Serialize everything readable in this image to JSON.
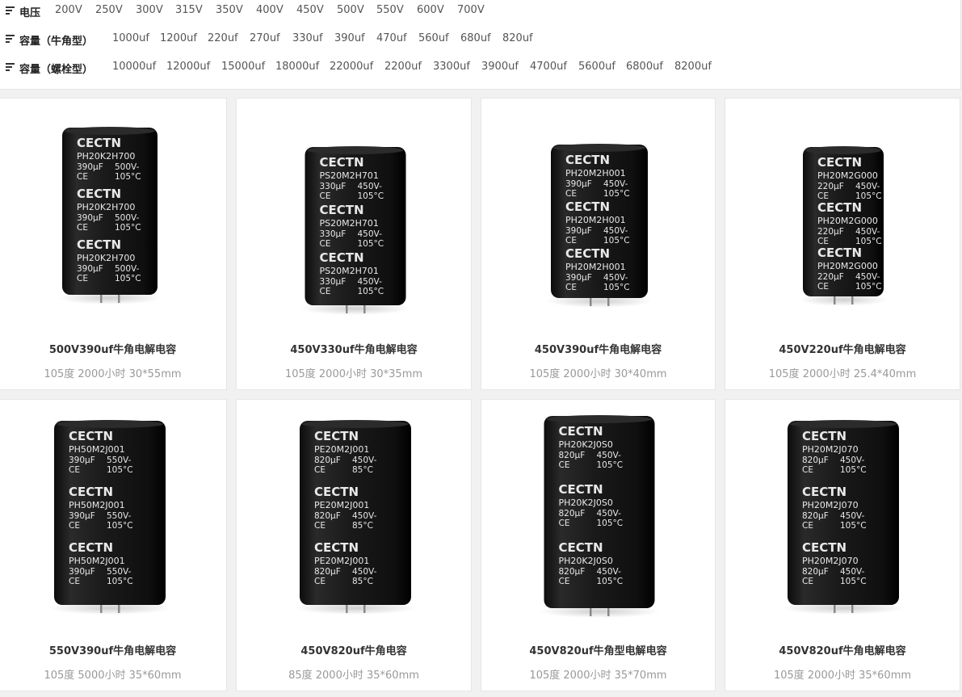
{
  "filters": [
    {
      "label": "电压",
      "options": [
        "200V",
        "250V",
        "300V",
        "315V",
        "350V",
        "400V",
        "450V",
        "500V",
        "550V",
        "600V",
        "700V"
      ]
    },
    {
      "label": "容量（牛角型）",
      "options": [
        "1000uf",
        "1200uf",
        "220uf",
        "270uf",
        "330uf",
        "390uf",
        "470uf",
        "560uf",
        "680uf",
        "820uf"
      ]
    },
    {
      "label": "容量（螺栓型）",
      "options": [
        "10000uf",
        "12000uf",
        "15000uf",
        "18000uf",
        "22000uf",
        "2200uf",
        "3300uf",
        "3900uf",
        "4700uf",
        "5600uf",
        "6800uf",
        "8200uf"
      ]
    }
  ],
  "products": [
    {
      "title": "500V390uf牛角电解电容",
      "spec": "105度 2000小时 30*55mm",
      "printing": {
        "brand": "CECTN",
        "model": "PH20K2H700",
        "cap": "390µF",
        "volt": "500V-",
        "ce": "CE",
        "temp": "105°C"
      }
    },
    {
      "title": "450V330uf牛角电解电容",
      "spec": "105度 2000小时 30*35mm",
      "printing": {
        "brand": "CECTN",
        "model": "PS20M2H701",
        "cap": "330µF",
        "volt": "450V-",
        "ce": "CE",
        "temp": "105°C"
      }
    },
    {
      "title": "450V390uf牛角电解电容",
      "spec": "105度 2000小时 30*40mm",
      "printing": {
        "brand": "CECTN",
        "model": "PH20M2H001",
        "cap": "390µF",
        "volt": "450V-",
        "ce": "CE",
        "temp": "105°C"
      }
    },
    {
      "title": "450V220uf牛角电解电容",
      "spec": "105度 2000小时 25.4*40mm",
      "printing": {
        "brand": "CECTN",
        "model": "PH20M2G000",
        "cap": "220µF",
        "volt": "450V-",
        "ce": "CE",
        "temp": "105°C"
      }
    },
    {
      "title": "550V390uf牛角电解电容",
      "spec": "105度 5000小时 35*60mm",
      "printing": {
        "brand": "CECTN",
        "model": "PH50M2J001",
        "cap": "390µF",
        "volt": "550V-",
        "ce": "CE",
        "temp": "105°C"
      }
    },
    {
      "title": "450V820uf牛角电容",
      "spec": "85度 2000小时 35*60mm",
      "printing": {
        "brand": "CECTN",
        "model": "PE20M2J001",
        "cap": "820µF",
        "volt": "450V-",
        "ce": "CE",
        "temp": "85°C"
      }
    },
    {
      "title": "450V820uf牛角型电解电容",
      "spec": "105度 2000小时 35*70mm",
      "printing": {
        "brand": "CECTN",
        "model": "PH20K2J0S0",
        "cap": "820µF",
        "volt": "450V-",
        "ce": "CE",
        "temp": "105°C"
      }
    },
    {
      "title": "450V820uf牛角电解电容",
      "spec": "105度 2000小时 35*60mm",
      "printing": {
        "brand": "CECTN",
        "model": "PH20M2J070",
        "cap": "820µF",
        "volt": "450V-",
        "ce": "CE",
        "temp": "105°C"
      }
    }
  ]
}
